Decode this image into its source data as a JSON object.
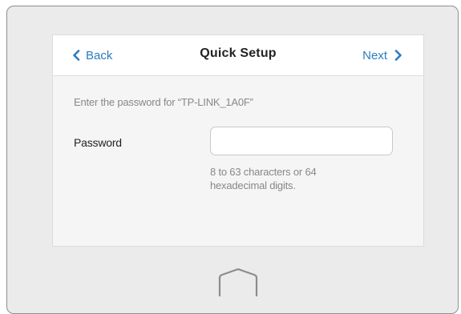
{
  "header": {
    "back_label": "Back",
    "title": "Quick Setup",
    "next_label": "Next"
  },
  "form": {
    "prompt": "Enter the password for “TP-LINK_1A0F”",
    "password_label": "Password",
    "password_value": "",
    "password_hint": "8 to 63 characters or 64 hexadecimal digits."
  },
  "icons": {
    "back": "chevron-left-icon",
    "next": "chevron-right-icon",
    "home": "home-icon"
  },
  "colors": {
    "accent": "#2a7cc0",
    "frame": "#ebebeb",
    "panel": "#f5f5f5"
  }
}
